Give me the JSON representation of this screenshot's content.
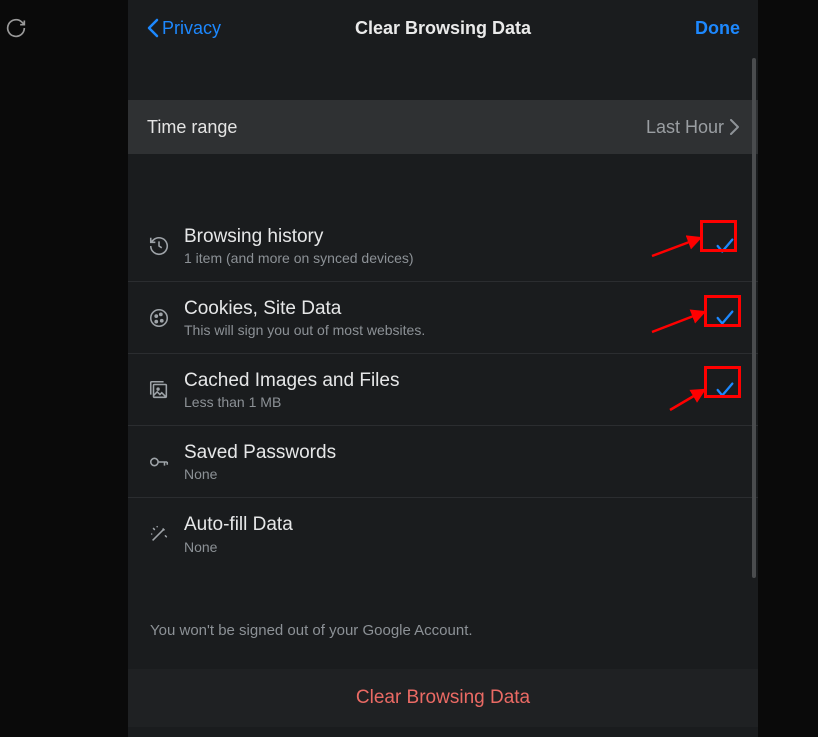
{
  "nav": {
    "back": "Privacy",
    "title": "Clear Browsing Data",
    "done": "Done"
  },
  "time": {
    "label": "Time range",
    "value": "Last Hour"
  },
  "items": [
    {
      "title": "Browsing history",
      "sub": "1 item (and more on synced devices)",
      "checked": true
    },
    {
      "title": "Cookies, Site Data",
      "sub": "This will sign you out of most websites.",
      "checked": true
    },
    {
      "title": "Cached Images and Files",
      "sub": "Less than 1 MB",
      "checked": true
    },
    {
      "title": "Saved Passwords",
      "sub": "None",
      "checked": false
    },
    {
      "title": "Auto-fill Data",
      "sub": "None",
      "checked": false
    }
  ],
  "footer": "You won't be signed out of your Google Account.",
  "clear": "Clear Browsing Data"
}
